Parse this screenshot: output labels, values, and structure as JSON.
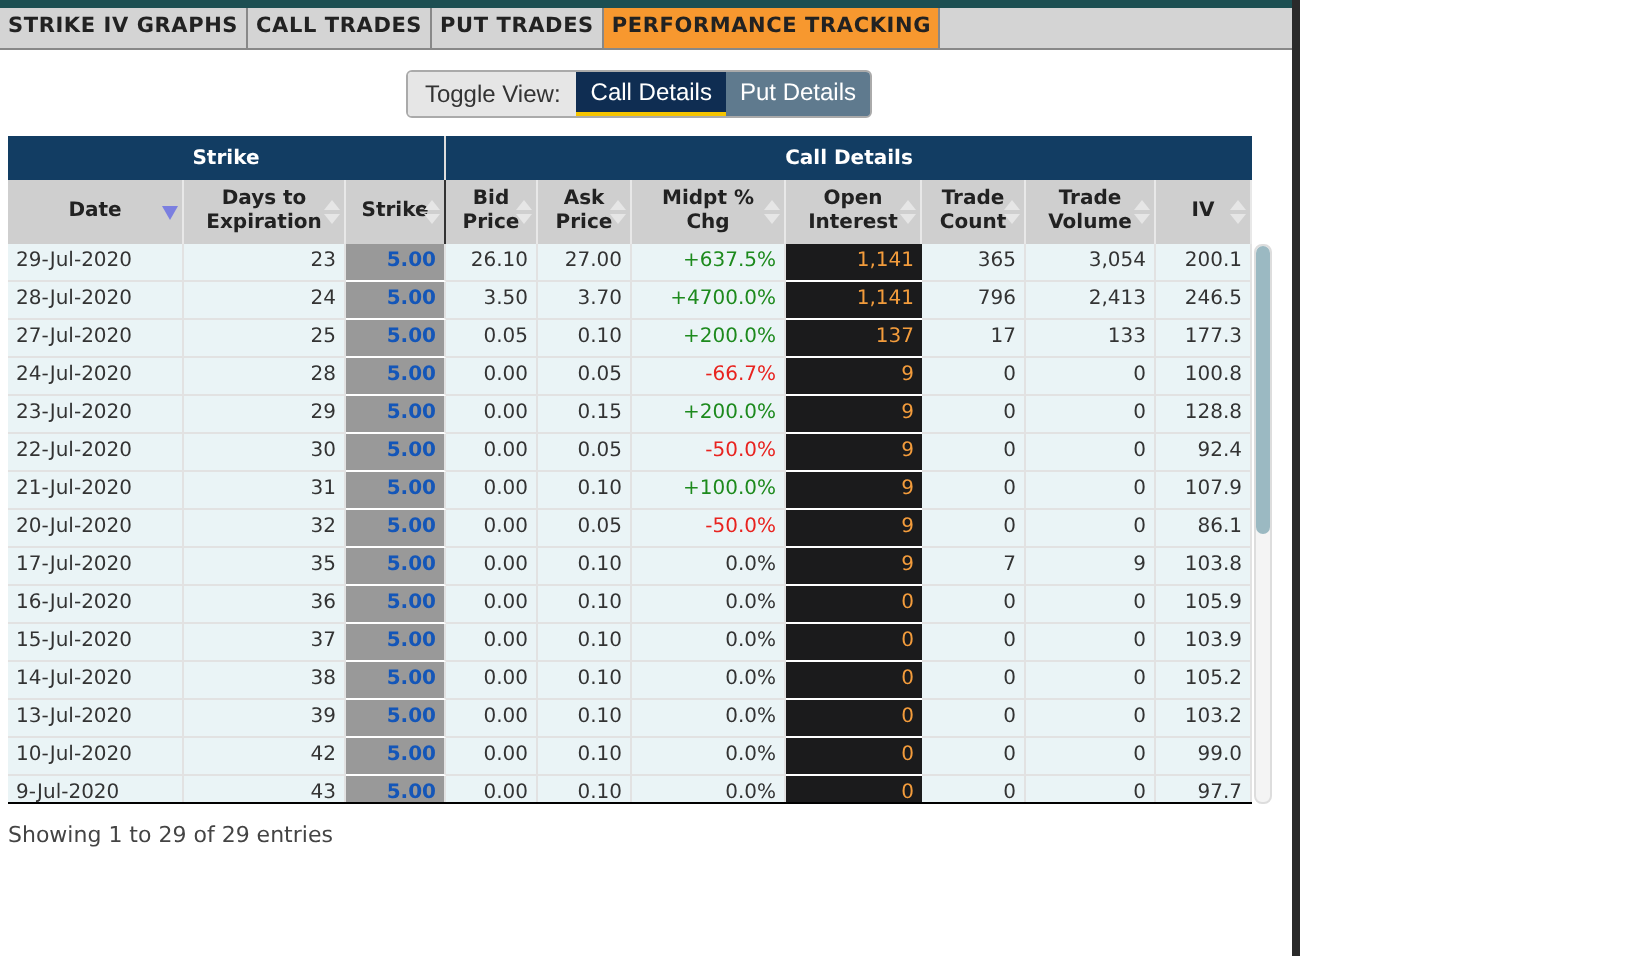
{
  "tabs": [
    {
      "label": "STRIKE IV GRAPHS",
      "selected": false
    },
    {
      "label": "CALL TRADES",
      "selected": false
    },
    {
      "label": "PUT TRADES",
      "selected": false
    },
    {
      "label": "PERFORMANCE TRACKING",
      "selected": true
    }
  ],
  "toggle": {
    "label": "Toggle View:",
    "options": [
      {
        "label": "Call Details",
        "selected": true
      },
      {
        "label": "Put Details",
        "selected": false
      }
    ]
  },
  "table": {
    "groups": [
      {
        "label": "Strike"
      },
      {
        "label": "Call Details"
      }
    ],
    "columns": [
      {
        "label": "Date",
        "sorted": true
      },
      {
        "label": "Days to Expiration",
        "sorted": false
      },
      {
        "label": "Strike",
        "sorted": false
      },
      {
        "label": "Bid Price",
        "sorted": false
      },
      {
        "label": "Ask Price",
        "sorted": false
      },
      {
        "label": "Midpt % Chg",
        "sorted": false
      },
      {
        "label": "Open Interest",
        "sorted": false
      },
      {
        "label": "Trade Count",
        "sorted": false
      },
      {
        "label": "Trade Volume",
        "sorted": false
      },
      {
        "label": "IV",
        "sorted": false
      }
    ],
    "rows": [
      {
        "date": "29-Jul-2020",
        "days": "23",
        "strike": "5.00",
        "bid": "26.10",
        "ask": "27.00",
        "midpt_chg": "+637.5%",
        "color": "#1d8a1d",
        "open_interest": "1,141",
        "trade_count": "365",
        "trade_volume": "3,054",
        "iv": "200.1"
      },
      {
        "date": "28-Jul-2020",
        "days": "24",
        "strike": "5.00",
        "bid": "3.50",
        "ask": "3.70",
        "midpt_chg": "+4700.0%",
        "color": "#1d8a1d",
        "open_interest": "1,141",
        "trade_count": "796",
        "trade_volume": "2,413",
        "iv": "246.5"
      },
      {
        "date": "27-Jul-2020",
        "days": "25",
        "strike": "5.00",
        "bid": "0.05",
        "ask": "0.10",
        "midpt_chg": "+200.0%",
        "color": "#1d8a1d",
        "open_interest": "137",
        "trade_count": "17",
        "trade_volume": "133",
        "iv": "177.3"
      },
      {
        "date": "24-Jul-2020",
        "days": "28",
        "strike": "5.00",
        "bid": "0.00",
        "ask": "0.05",
        "midpt_chg": "-66.7%",
        "color": "#e8231f",
        "open_interest": "9",
        "trade_count": "0",
        "trade_volume": "0",
        "iv": "100.8"
      },
      {
        "date": "23-Jul-2020",
        "days": "29",
        "strike": "5.00",
        "bid": "0.00",
        "ask": "0.15",
        "midpt_chg": "+200.0%",
        "color": "#1d8a1d",
        "open_interest": "9",
        "trade_count": "0",
        "trade_volume": "0",
        "iv": "128.8"
      },
      {
        "date": "22-Jul-2020",
        "days": "30",
        "strike": "5.00",
        "bid": "0.00",
        "ask": "0.05",
        "midpt_chg": "-50.0%",
        "color": "#e8231f",
        "open_interest": "9",
        "trade_count": "0",
        "trade_volume": "0",
        "iv": "92.4"
      },
      {
        "date": "21-Jul-2020",
        "days": "31",
        "strike": "5.00",
        "bid": "0.00",
        "ask": "0.10",
        "midpt_chg": "+100.0%",
        "color": "#1d8a1d",
        "open_interest": "9",
        "trade_count": "0",
        "trade_volume": "0",
        "iv": "107.9"
      },
      {
        "date": "20-Jul-2020",
        "days": "32",
        "strike": "5.00",
        "bid": "0.00",
        "ask": "0.05",
        "midpt_chg": "-50.0%",
        "color": "#e8231f",
        "open_interest": "9",
        "trade_count": "0",
        "trade_volume": "0",
        "iv": "86.1"
      },
      {
        "date": "17-Jul-2020",
        "days": "35",
        "strike": "5.00",
        "bid": "0.00",
        "ask": "0.10",
        "midpt_chg": "0.0%",
        "color": "#333333",
        "open_interest": "9",
        "trade_count": "7",
        "trade_volume": "9",
        "iv": "103.8"
      },
      {
        "date": "16-Jul-2020",
        "days": "36",
        "strike": "5.00",
        "bid": "0.00",
        "ask": "0.10",
        "midpt_chg": "0.0%",
        "color": "#333333",
        "open_interest": "0",
        "trade_count": "0",
        "trade_volume": "0",
        "iv": "105.9"
      },
      {
        "date": "15-Jul-2020",
        "days": "37",
        "strike": "5.00",
        "bid": "0.00",
        "ask": "0.10",
        "midpt_chg": "0.0%",
        "color": "#333333",
        "open_interest": "0",
        "trade_count": "0",
        "trade_volume": "0",
        "iv": "103.9"
      },
      {
        "date": "14-Jul-2020",
        "days": "38",
        "strike": "5.00",
        "bid": "0.00",
        "ask": "0.10",
        "midpt_chg": "0.0%",
        "color": "#333333",
        "open_interest": "0",
        "trade_count": "0",
        "trade_volume": "0",
        "iv": "105.2"
      },
      {
        "date": "13-Jul-2020",
        "days": "39",
        "strike": "5.00",
        "bid": "0.00",
        "ask": "0.10",
        "midpt_chg": "0.0%",
        "color": "#333333",
        "open_interest": "0",
        "trade_count": "0",
        "trade_volume": "0",
        "iv": "103.2"
      },
      {
        "date": "10-Jul-2020",
        "days": "42",
        "strike": "5.00",
        "bid": "0.00",
        "ask": "0.10",
        "midpt_chg": "0.0%",
        "color": "#333333",
        "open_interest": "0",
        "trade_count": "0",
        "trade_volume": "0",
        "iv": "99.0"
      },
      {
        "date": "9-Jul-2020",
        "days": "43",
        "strike": "5.00",
        "bid": "0.00",
        "ask": "0.10",
        "midpt_chg": "0.0%",
        "color": "#333333",
        "open_interest": "0",
        "trade_count": "0",
        "trade_volume": "0",
        "iv": "97.7"
      }
    ]
  },
  "footer": "Showing 1 to 29 of 29 entries"
}
